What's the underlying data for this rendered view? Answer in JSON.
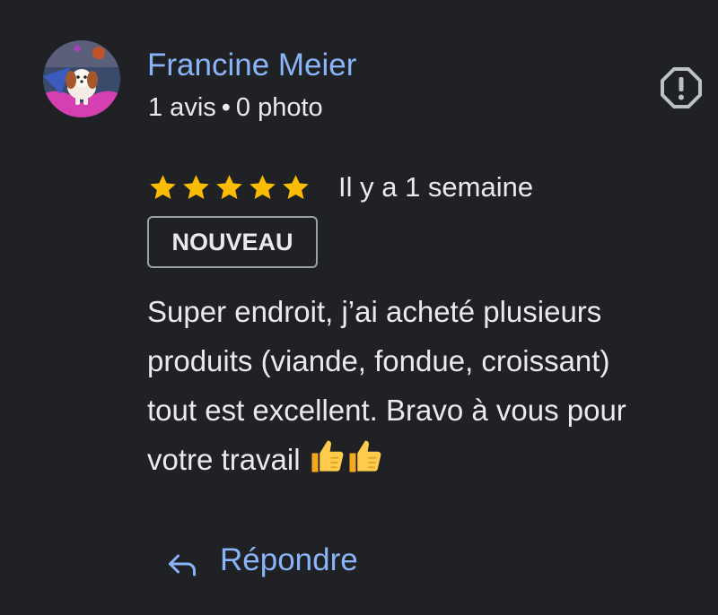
{
  "reviewer": {
    "name": "Francine Meier",
    "reviews": "1 avis",
    "separator": "•",
    "photos": "0 photo"
  },
  "rating": {
    "stars": 5,
    "max_stars": 5,
    "date": "Il y a 1 semaine"
  },
  "badge": "NOUVEAU",
  "review": {
    "lines": [
      "Super endroit, j’ai acheté plusieurs",
      "produits (viande, fondue, croissant)",
      "tout est excellent. Bravo à vous pour",
      "votre travail"
    ],
    "emoji": "👍👍"
  },
  "actions": {
    "reply_label": "Répondre"
  },
  "colors": {
    "background": "#202124",
    "accent": "#8ab4f8",
    "star": "#fbbc04",
    "text": "#e8eaed"
  },
  "icons": {
    "report": "report-icon",
    "reply": "reply-arrow-icon",
    "star": "star-icon",
    "thumb": "thumbs-up-icon"
  }
}
